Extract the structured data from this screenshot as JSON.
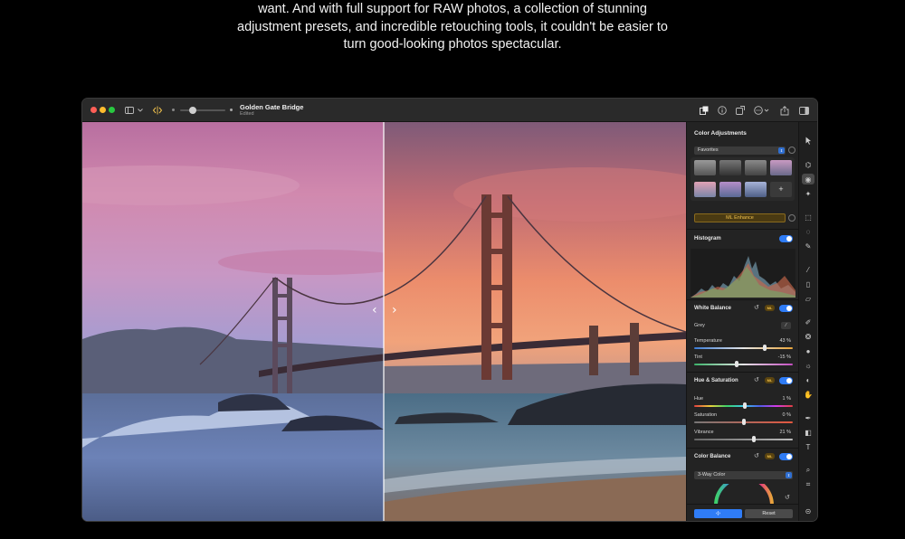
{
  "marketing": {
    "lines": [
      "want. And with full support for RAW photos, a collection of stunning",
      "adjustment presets, and incredible retouching tools, it couldn't be easier to",
      "turn good-looking photos spectacular."
    ]
  },
  "window": {
    "title": "Golden Gate Bridge",
    "subtitle": "Edited",
    "toolbar_left_icons": [
      "sidebar-icon",
      "chevron-down-icon",
      "compare-icon",
      "zoom-out-icon",
      "zoom-in-icon"
    ],
    "toolbar_right_icons": [
      "adjust-icon",
      "info-icon",
      "share-frame-icon",
      "more-icon",
      "share-icon",
      "sidebar-right-icon"
    ]
  },
  "compare": {
    "left_arrow": "‹",
    "right_arrow": "›"
  },
  "panel": {
    "title": "Color Adjustments",
    "preset_select": "Favorites",
    "add_preset": "+",
    "ml_enhance": "ML Enhance",
    "histogram": {
      "title": "Histogram",
      "enabled": true
    },
    "white_balance": {
      "title": "White Balance",
      "ml_badge": "ML",
      "enabled": true,
      "grey_label": "Grey",
      "sliders": [
        {
          "label": "Temperature",
          "value": "43 %",
          "fraction": 0.72
        },
        {
          "label": "Tint",
          "value": "-15 %",
          "fraction": 0.43
        }
      ]
    },
    "hue_saturation": {
      "title": "Hue & Saturation",
      "ml_badge": "ML",
      "enabled": true,
      "sliders": [
        {
          "label": "Hue",
          "value": "1 %",
          "fraction": 0.51
        },
        {
          "label": "Saturation",
          "value": "0 %",
          "fraction": 0.5
        },
        {
          "label": "Vibrance",
          "value": "21 %",
          "fraction": 0.61
        }
      ]
    },
    "color_balance": {
      "title": "Color Balance",
      "ml_badge": "ML",
      "enabled": true,
      "mode_select": "3-Way Color"
    },
    "compare_button": "‹|›",
    "reset_button": "Reset"
  },
  "colors": {
    "accent": "#2f7cf6",
    "ml_gold": "#f1c24d",
    "background": "#000000",
    "panel": "#232323"
  }
}
